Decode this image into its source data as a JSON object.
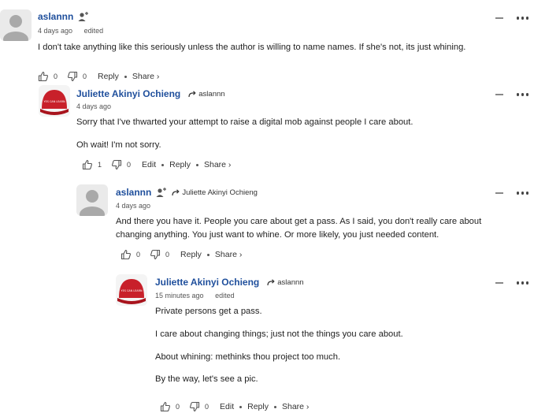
{
  "comments": [
    {
      "author": "aslannn",
      "time": "4 days ago",
      "edited": "edited",
      "paragraphs": [
        "I don't take anything like this seriously unless the author is willing to name names. If she's not, its just whining."
      ],
      "likes": "0",
      "dislikes": "0",
      "reply_label": "Reply",
      "share_label": "Share ›"
    },
    {
      "author": "Juliette Akinyi Ochieng",
      "reply_to": "aslannn",
      "time": "4 days ago",
      "paragraphs": [
        "Sorry that I've thwarted your attempt to raise a digital mob against people I care about.",
        "Oh wait! I'm not sorry."
      ],
      "likes": "1",
      "dislikes": "0",
      "edit_label": "Edit",
      "reply_label": "Reply",
      "share_label": "Share ›"
    },
    {
      "author": "aslannn",
      "reply_to": "Juliette Akinyi Ochieng",
      "time": "4 days ago",
      "paragraphs": [
        "And there you have it. People you care about get a pass. As I said, you don't really care about changing anything. You just want to whine. Or more likely, you just needed content."
      ],
      "likes": "0",
      "dislikes": "0",
      "reply_label": "Reply",
      "share_label": "Share ›"
    },
    {
      "author": "Juliette Akinyi Ochieng",
      "reply_to": "aslannn",
      "time": "15 minutes ago",
      "edited": "edited",
      "paragraphs": [
        "Private persons get a pass.",
        "I care about changing things; just not the things you care about.",
        "About whining: methinks thou project too much.",
        "By the way, let's see a pic."
      ],
      "likes": "0",
      "dislikes": "0",
      "edit_label": "Edit",
      "reply_label": "Reply",
      "share_label": "Share ›"
    }
  ]
}
